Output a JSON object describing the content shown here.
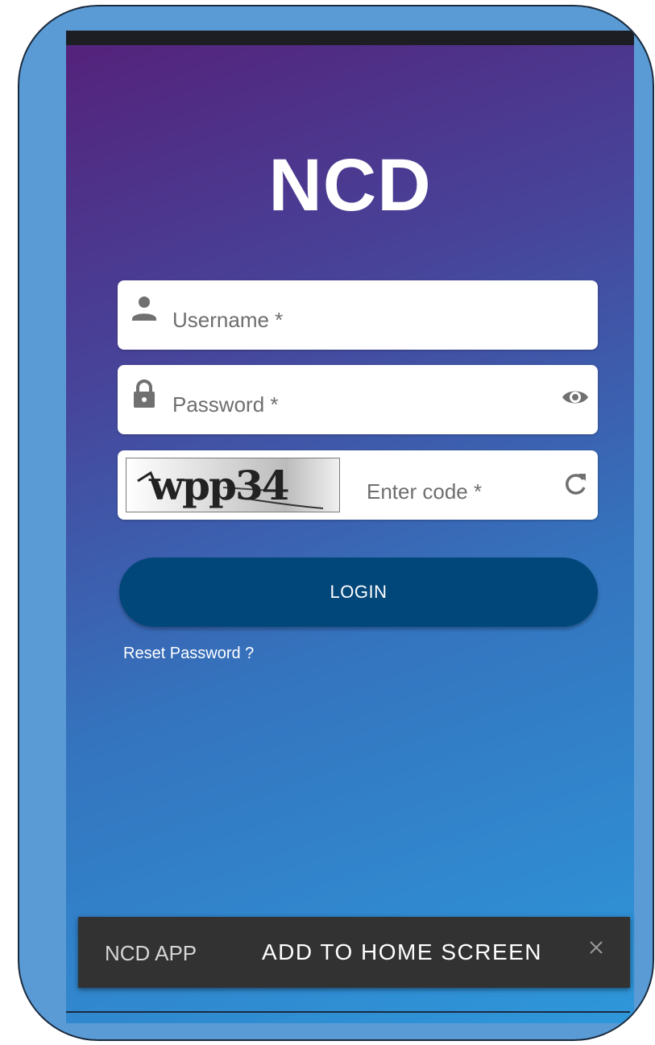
{
  "app": {
    "title": "NCD"
  },
  "login_form": {
    "username": {
      "label": "Username *",
      "icon": "person-icon"
    },
    "password": {
      "label": "Password *",
      "icon": "lock-icon",
      "toggle_icon": "eye-icon"
    },
    "captcha": {
      "image_text": "wpp34",
      "label": "Enter code *",
      "refresh_icon": "refresh-icon"
    },
    "login_label": "LOGIN",
    "reset_label": "Reset Password ?"
  },
  "install_banner": {
    "app_name": "NCD APP",
    "action_label": "ADD TO HOME SCREEN",
    "close_icon": "close-icon"
  },
  "colors": {
    "gradient_start": "#55217a",
    "gradient_end": "#2e97da",
    "login_button": "#02477a",
    "frame": "#5b9bd5",
    "banner": "#323232"
  }
}
